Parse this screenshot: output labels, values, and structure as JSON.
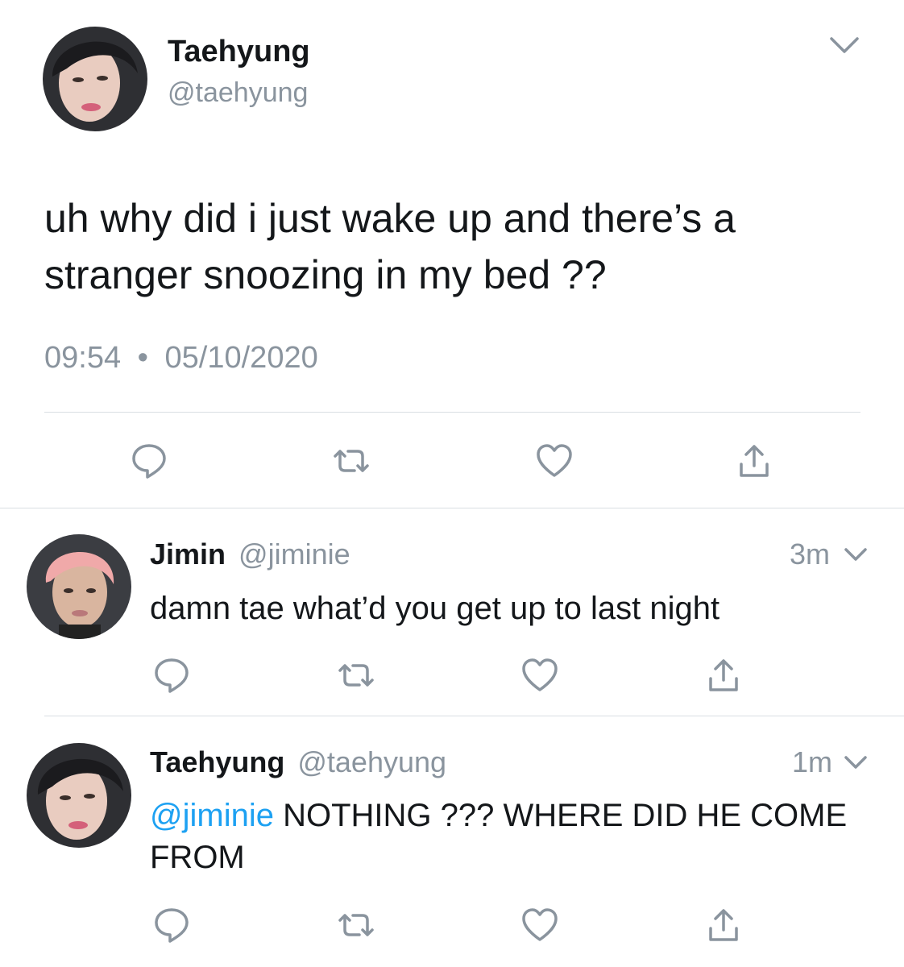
{
  "main_tweet": {
    "display_name": "Taehyung",
    "handle": "@taehyung",
    "text": "uh why did i just wake up and there’s a stranger snoozing in my bed ??",
    "time": "09:54",
    "separator": "•",
    "date": "05/10/2020"
  },
  "replies": [
    {
      "display_name": "Jimin",
      "handle": "@jiminie",
      "age": "3m",
      "text": "damn tae what’d you get up to last night"
    },
    {
      "display_name": "Taehyung",
      "handle": "@taehyung",
      "age": "1m",
      "mention": "@jiminie",
      "text": "NOTHING ??? WHERE DID HE COME FROM"
    }
  ],
  "icons": {
    "menu": "chevron-down-icon",
    "reply": "reply-icon",
    "retweet": "retweet-icon",
    "like": "heart-icon",
    "share": "share-icon"
  },
  "colors": {
    "text": "#14171a",
    "secondary": "#8a949e",
    "link": "#1da1f2",
    "divider": "#d9dee3"
  }
}
